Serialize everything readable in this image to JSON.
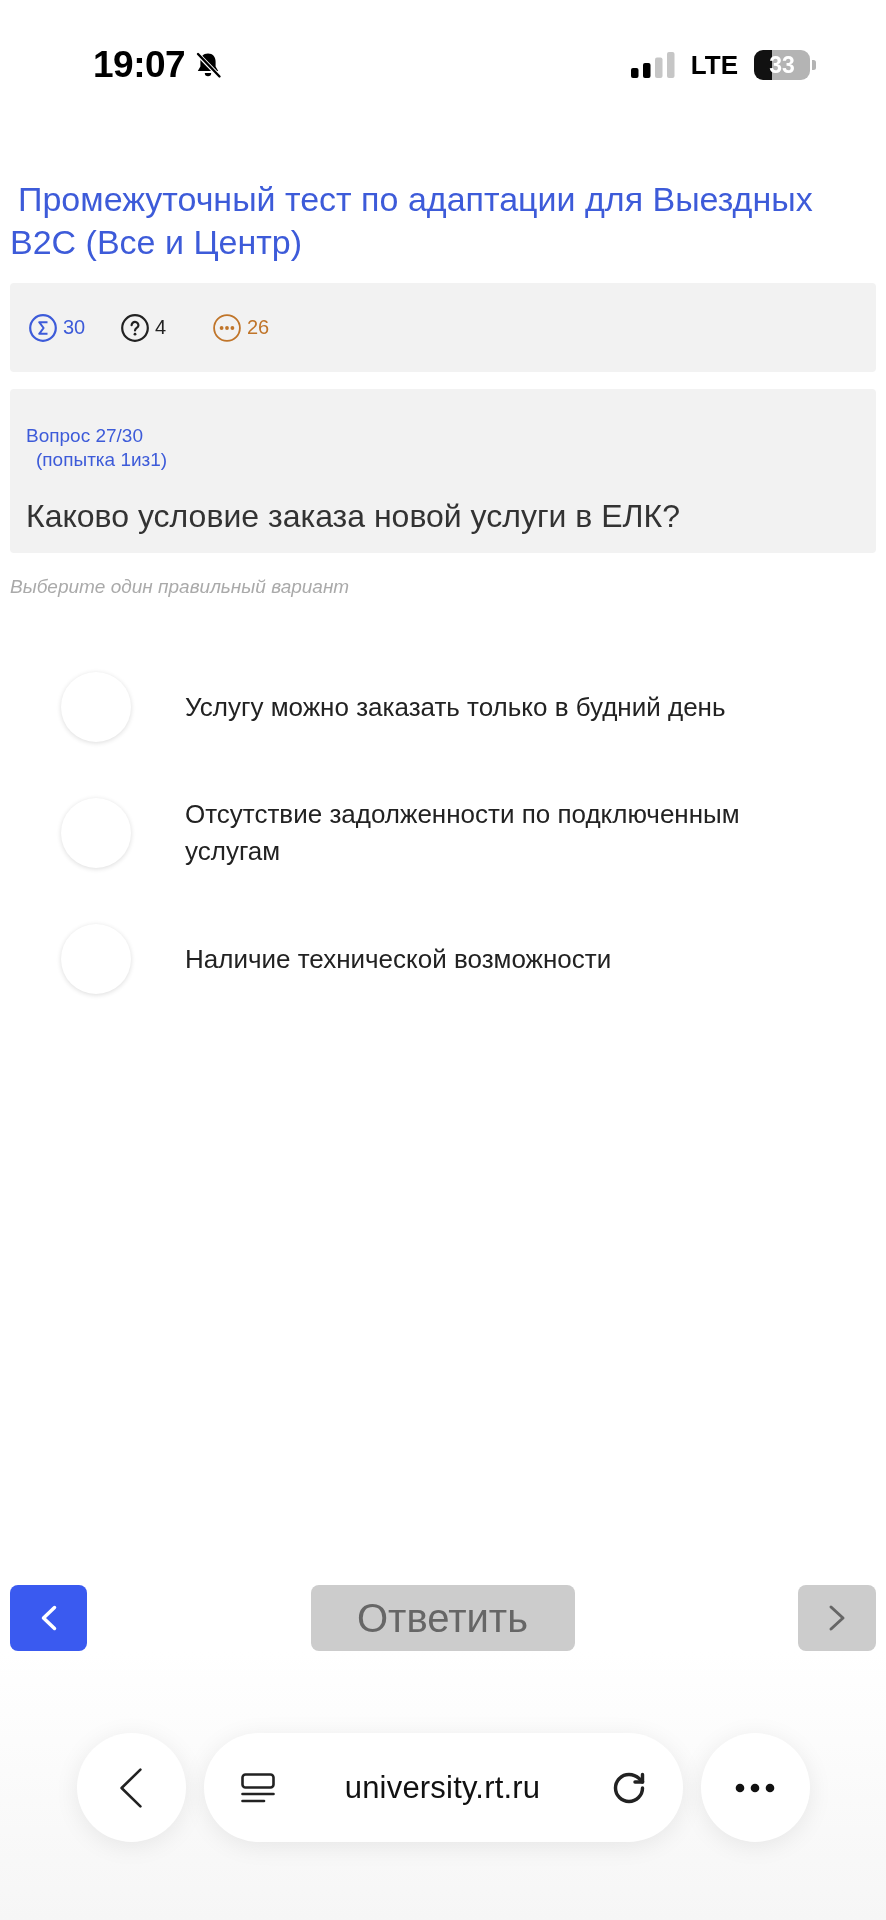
{
  "status_bar": {
    "time": "19:07",
    "muted": true,
    "network": "LTE",
    "battery": "33"
  },
  "title": "Промежуточный тест по адаптации для Выездных B2C (Все и Центр)",
  "stats": [
    {
      "kind": "sigma",
      "value": "30",
      "color": "#3d5bd9"
    },
    {
      "kind": "question",
      "value": "4",
      "color": "#222222"
    },
    {
      "kind": "dots",
      "value": "26",
      "color": "#c0752a"
    }
  ],
  "question": {
    "number": "Вопрос 27/30",
    "attempt": "(попытка 1из1)",
    "text": "Каково условие заказа новой услуги в ЕЛК?"
  },
  "hint": "Выберите один правильный вариант",
  "options": [
    {
      "label": "Услугу можно заказать только в будний день",
      "selected": false
    },
    {
      "label": "Отсутствие задолженности по подключенным услугам",
      "selected": false
    },
    {
      "label": "Наличие технической возможности",
      "selected": false
    }
  ],
  "nav": {
    "back": {
      "disabled": false
    },
    "answer": {
      "label": "Ответить",
      "disabled": true
    },
    "next": {
      "disabled": true
    }
  },
  "browser": {
    "url": "university.rt.ru"
  }
}
